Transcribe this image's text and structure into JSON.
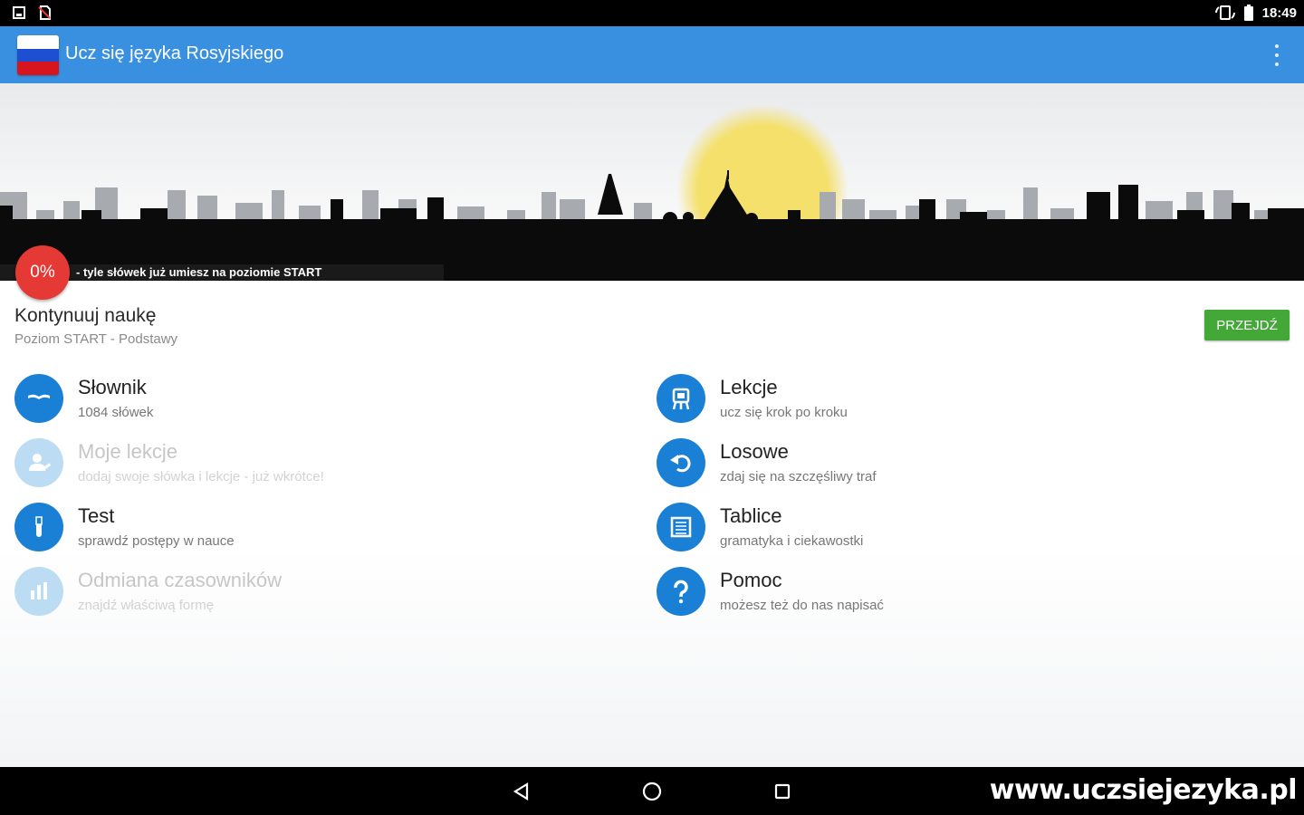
{
  "status_bar": {
    "time": "18:49",
    "left_icons": [
      "screenshot-icon",
      "no-sim-icon"
    ],
    "right_icons": [
      "screen-rotation-icon",
      "battery-icon"
    ]
  },
  "app_bar": {
    "title": "Ucz się języka Rosyjskiego",
    "flag_colors": [
      "#ffffff",
      "#1f4fd1",
      "#d8141e"
    ]
  },
  "banner": {
    "progress_percent": "0%",
    "progress_caption": "- tyle słówek już umiesz na poziomie START"
  },
  "continue": {
    "title": "Kontynuuj naukę",
    "subtitle": "Poziom START - Podstawy",
    "button_label": "PRZEJDŹ"
  },
  "menu": {
    "left": [
      {
        "label": "Słownik",
        "sub": "1084 słówek",
        "icon": "book-icon",
        "enabled": true
      },
      {
        "label": "Moje lekcje",
        "sub": "dodaj swoje słówka i lekcje - już wkrótce!",
        "icon": "user-edit-icon",
        "enabled": false
      },
      {
        "label": "Test",
        "sub": "sprawdź postępy w nauce",
        "icon": "test-tube-icon",
        "enabled": true
      },
      {
        "label": "Odmiana czasowników",
        "sub": "znajdź właściwą formę",
        "icon": "bars-icon",
        "enabled": false
      }
    ],
    "right": [
      {
        "label": "Lekcje",
        "sub": "ucz się krok po kroku",
        "icon": "easel-icon",
        "enabled": true
      },
      {
        "label": "Losowe",
        "sub": "zdaj się na szczęśliwy traf",
        "icon": "undo-icon",
        "enabled": true
      },
      {
        "label": "Tablice",
        "sub": "gramatyka i ciekawostki",
        "icon": "board-icon",
        "enabled": true
      },
      {
        "label": "Pomoc",
        "sub": "możesz też do nas napisać",
        "icon": "help-icon",
        "enabled": true
      }
    ]
  },
  "nav_bar": {
    "watermark": "www.uczsiejezyka.pl",
    "buttons": [
      "back-icon",
      "home-icon",
      "recents-icon"
    ]
  },
  "colors": {
    "app_bar": "#3a90e0",
    "icon_blue": "#1a80d6",
    "icon_disabled": "#bcdcf3",
    "progress_red": "#e53935",
    "go_green": "#43a838"
  }
}
